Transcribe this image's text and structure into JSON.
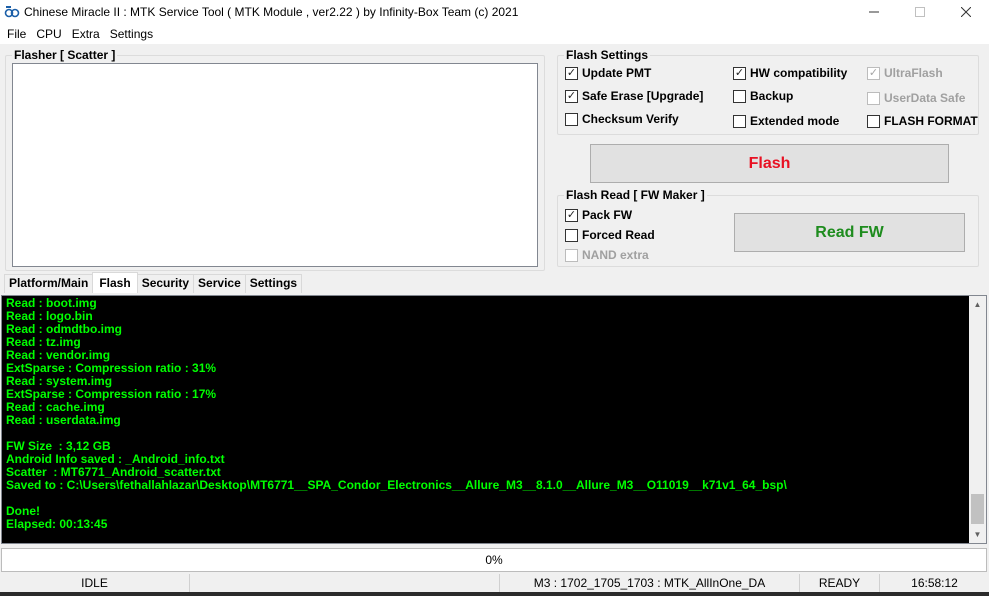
{
  "window": {
    "title": "Chinese Miracle II : MTK Service Tool ( MTK Module , ver2.22  ) by Infinity-Box Team (c) 2021"
  },
  "menu": [
    "File",
    "CPU",
    "Extra",
    "Settings"
  ],
  "flasher": {
    "title": "Flasher [ Scatter ]"
  },
  "flash_settings": {
    "title": "Flash Settings",
    "options": [
      {
        "label": "Update PMT",
        "checked": true,
        "enabled": true
      },
      {
        "label": "HW compatibility",
        "checked": true,
        "enabled": true
      },
      {
        "label": "UltraFlash",
        "checked": true,
        "enabled": false
      },
      {
        "label": "Safe Erase [Upgrade]",
        "checked": true,
        "enabled": true
      },
      {
        "label": "Backup",
        "checked": false,
        "enabled": true
      },
      {
        "label": "UserData Safe",
        "checked": false,
        "enabled": false
      },
      {
        "label": "Checksum Verify",
        "checked": false,
        "enabled": true
      },
      {
        "label": "Extended mode",
        "checked": false,
        "enabled": true
      },
      {
        "label": "FLASH FORMAT",
        "checked": false,
        "enabled": true
      }
    ]
  },
  "flash_button": {
    "label": "Flash",
    "color": "#e81123"
  },
  "flash_read": {
    "title": "Flash Read [ FW Maker ]",
    "options": [
      {
        "label": "Pack FW",
        "checked": true,
        "enabled": true
      },
      {
        "label": "Forced Read",
        "checked": false,
        "enabled": true
      },
      {
        "label": "NAND extra",
        "checked": false,
        "enabled": false
      }
    ],
    "read_button": {
      "label": "Read FW",
      "color": "#1e8c1e"
    }
  },
  "tabs": [
    {
      "label": "Platform/Main",
      "active": false
    },
    {
      "label": "Flash",
      "active": true
    },
    {
      "label": "Security",
      "active": false
    },
    {
      "label": "Service",
      "active": false
    },
    {
      "label": "Settings",
      "active": false
    }
  ],
  "log": {
    "color": "#00ff00",
    "lines": [
      "Read : boot.img",
      "Read : logo.bin",
      "Read : odmdtbo.img",
      "Read : tz.img",
      "Read : vendor.img",
      "ExtSparse : Compression ratio : 31%",
      "Read : system.img",
      "ExtSparse : Compression ratio : 17%",
      "Read : cache.img",
      "Read : userdata.img",
      "",
      "FW Size  : 3,12 GB",
      "Android Info saved : _Android_info.txt",
      "Scatter  : MT6771_Android_scatter.txt",
      "Saved to : C:\\Users\\fethallahlazar\\Desktop\\MT6771__SPA_Condor_Electronics__Allure_M3__8.1.0__Allure_M3__O11019__k71v1_64_bsp\\",
      "",
      "Done!",
      "Elapsed: 00:13:45"
    ]
  },
  "progress": {
    "percent": 0,
    "label": "0%"
  },
  "status": {
    "state": "IDLE",
    "empty": "",
    "version": "M3 : 1702_1705_1703 : MTK_AllInOne_DA",
    "ready": "READY",
    "time": "16:58:12"
  }
}
